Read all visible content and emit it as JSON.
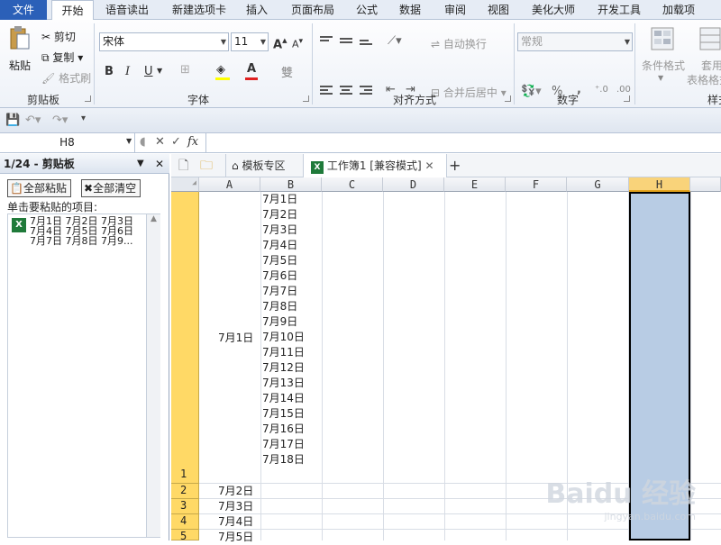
{
  "menu": {
    "tabs": [
      "文件",
      "开始",
      "语音读出",
      "新建选项卡",
      "插入",
      "页面布局",
      "公式",
      "数据",
      "审阅",
      "视图",
      "美化大师",
      "开发工具",
      "加载项"
    ]
  },
  "ribbon": {
    "clipboard": {
      "paste": "粘贴",
      "cut": "剪切",
      "copy": "复制",
      "format_painter": "格式刷",
      "label": "剪贴板"
    },
    "font": {
      "name": "宋体",
      "size": "11",
      "bold": "B",
      "italic": "I",
      "underline": "U",
      "label": "字体"
    },
    "align": {
      "wrap": "自动换行",
      "merge": "合并后居中",
      "label": "对齐方式"
    },
    "number": {
      "format": "常规",
      "percent": "%",
      "comma": ",",
      "label": "数字"
    },
    "styles": {
      "conditional": "条件格式",
      "apply": "套用",
      "apply2": "表格格式",
      "label": "样式"
    }
  },
  "formula_bar": {
    "name_box": "H8",
    "fx": "fx"
  },
  "pane": {
    "title": "1/24 - 剪贴板",
    "paste_all": "全部粘贴",
    "clear_all": "全部清空",
    "instruction": "单击要粘贴的项目:",
    "item_lines": [
      "7月1日 7月2日 7月3日",
      "7月4日 7月5日 7月6日",
      "7月7日 7月8日 7月9..."
    ]
  },
  "doc_tabs": {
    "template": "模板专区",
    "workbook": "工作簿1 [兼容模式]",
    "add": "+"
  },
  "grid": {
    "columns": [
      "A",
      "B",
      "C",
      "D",
      "E",
      "F",
      "G",
      "H"
    ],
    "rows": [
      "1",
      "2",
      "3",
      "4",
      "5"
    ],
    "b1_lines": [
      "7月1日",
      "7月2日",
      "7月3日",
      "7月4日",
      "7月5日",
      "7月6日",
      "7月7日",
      "7月8日",
      "7月9日",
      "7月10日",
      "7月11日",
      "7月12日",
      "7月13日",
      "7月14日",
      "7月15日",
      "7月16日",
      "7月17日",
      "7月18日"
    ],
    "a1": "7月1日",
    "a_values": [
      "7月2日",
      "7月3日",
      "7月4日",
      "7月5日"
    ]
  },
  "watermark": {
    "brand": "Baidu 经验",
    "url": "jingyan.baidu.com"
  },
  "colors": {
    "file_tab": "#2b60b8",
    "row_header": "#ffd966",
    "selection": "#b8cce4",
    "excel_green": "#1f7a3a"
  }
}
